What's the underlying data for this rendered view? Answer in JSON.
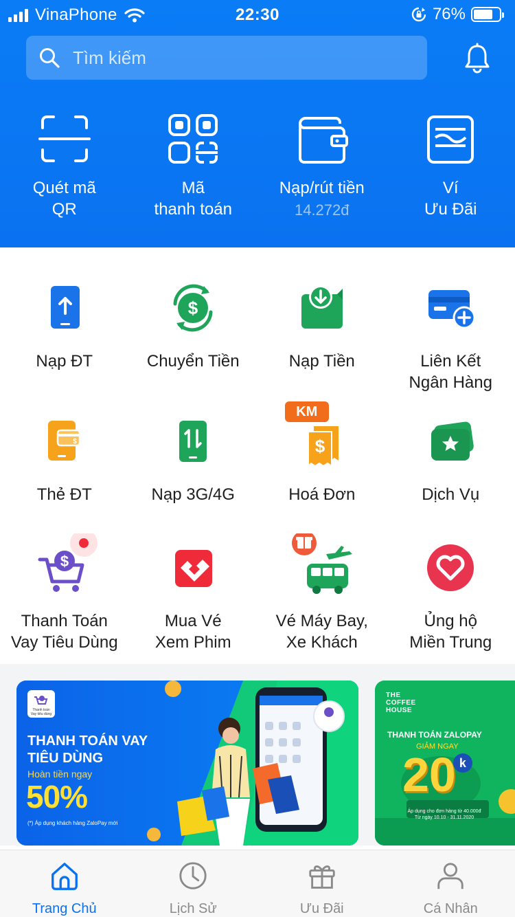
{
  "status_bar": {
    "carrier": "VinaPhone",
    "time": "22:30",
    "battery": "76%",
    "battery_level": 0.76
  },
  "search": {
    "placeholder": "Tìm kiếm"
  },
  "top_actions": [
    {
      "line1": "Quét mã",
      "line2": "QR",
      "icon": "qr-scan-icon"
    },
    {
      "line1": "Mã",
      "line2": "thanh toán",
      "icon": "payment-code-icon"
    },
    {
      "line1": "Nạp/rút tiền",
      "line2": "14.272đ",
      "icon": "wallet-icon"
    },
    {
      "line1": "Ví",
      "line2": "Ưu Đãi",
      "icon": "voucher-wallet-icon"
    }
  ],
  "services": [
    {
      "line1": "Nạp ĐT",
      "line2": "",
      "icon": "phone-topup-icon"
    },
    {
      "line1": "Chuyển Tiền",
      "line2": "",
      "icon": "money-transfer-icon"
    },
    {
      "line1": "Nạp Tiền",
      "line2": "",
      "icon": "deposit-icon"
    },
    {
      "line1": "Liên Kết",
      "line2": "Ngân Hàng",
      "icon": "bank-link-icon"
    },
    {
      "line1": "Thẻ ĐT",
      "line2": "",
      "icon": "phone-card-icon"
    },
    {
      "line1": "Nạp 3G/4G",
      "line2": "",
      "icon": "data-topup-icon"
    },
    {
      "line1": "Hoá Đơn",
      "line2": "",
      "icon": "bill-icon",
      "badge": "KM"
    },
    {
      "line1": "Dịch Vụ",
      "line2": "",
      "icon": "services-icon"
    },
    {
      "line1": "Thanh Toán",
      "line2": "Vay Tiêu Dùng",
      "icon": "loan-payment-icon"
    },
    {
      "line1": "Mua Vé",
      "line2": "Xem Phim",
      "icon": "movie-ticket-icon"
    },
    {
      "line1": "Vé Máy Bay,",
      "line2": "Xe Khách",
      "icon": "flight-bus-icon"
    },
    {
      "line1": "Ủng hộ",
      "line2": "Miền Trung",
      "icon": "donation-heart-icon"
    }
  ],
  "banner1": {
    "logo_line1": "Thanh toán",
    "logo_line2": "Vay tiêu dùng",
    "title_line1": "THANH TOÁN VAY",
    "title_line2": "TIÊU DÙNG",
    "subtitle": "Hoàn tiền ngay",
    "percent": "50%",
    "note": "(*) Áp dụng khách hàng ZaloPay mới"
  },
  "banner2": {
    "brand_line1": "THE",
    "brand_line2": "COFFEE",
    "brand_line3": "HOUSE",
    "title": "THANH TOÁN ZALOPAY",
    "subtitle": "GIẢM NGAY",
    "amount": "20",
    "unit": "k",
    "note_line1": "Áp dụng cho đơn hàng từ 40.000đ",
    "note_line2": "Từ ngày 10.10 - 31.11.2020"
  },
  "tabs": [
    {
      "label": "Trang Chủ",
      "icon": "home-icon",
      "active": true
    },
    {
      "label": "Lịch Sử",
      "icon": "clock-icon",
      "active": false
    },
    {
      "label": "Ưu Đãi",
      "icon": "gift-icon",
      "active": false
    },
    {
      "label": "Cá Nhân",
      "icon": "profile-icon",
      "active": false
    }
  ],
  "colors": {
    "brand_blue": "#0a72f0",
    "service_blue": "#1a73e8",
    "service_green": "#1fa55a",
    "service_orange": "#f7a21b",
    "service_purple": "#6b4fc8",
    "service_red": "#ef2b3a",
    "service_pink": "#e8344f"
  }
}
